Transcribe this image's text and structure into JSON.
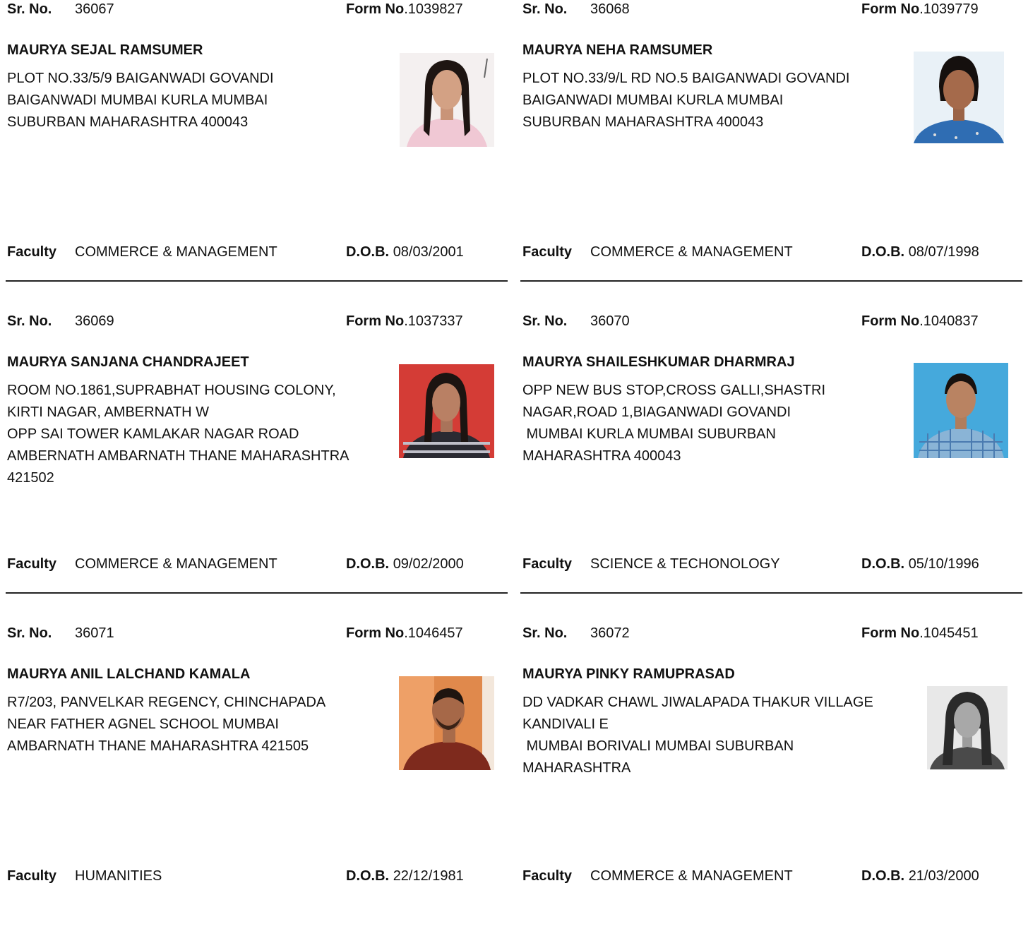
{
  "labels": {
    "sr": "Sr. No.",
    "form": "Form No",
    "faculty": "Faculty",
    "dob": "D.O.B."
  },
  "records": [
    {
      "sr_no": "36067",
      "form_no": ".1039827",
      "name": "MAURYA SEJAL RAMSUMER",
      "address": [
        "PLOT NO.33/5/9 BAIGANWADI GOVANDI",
        "BAIGANWADI MUMBAI KURLA MUMBAI",
        "SUBURBAN MAHARASHTRA 400043"
      ],
      "faculty": "COMMERCE & MANAGEMENT",
      "dob": "08/03/2001"
    },
    {
      "sr_no": "36068",
      "form_no": ".1039779",
      "name": "MAURYA NEHA RAMSUMER",
      "address": [
        "PLOT NO.33/9/L RD NO.5 BAIGANWADI GOVANDI",
        "BAIGANWADI MUMBAI KURLA MUMBAI",
        "SUBURBAN MAHARASHTRA 400043"
      ],
      "faculty": "COMMERCE & MANAGEMENT",
      "dob": "08/07/1998"
    },
    {
      "sr_no": "36069",
      "form_no": ".1037337",
      "name": "MAURYA SANJANA CHANDRAJEET",
      "address": [
        "ROOM NO.1861,SUPRABHAT HOUSING COLONY,",
        "KIRTI NAGAR, AMBERNATH W",
        "OPP SAI TOWER KAMLAKAR NAGAR ROAD",
        "AMBERNATH AMBARNATH THANE MAHARASHTRA",
        "421502"
      ],
      "faculty": "COMMERCE & MANAGEMENT",
      "dob": "09/02/2000"
    },
    {
      "sr_no": "36070",
      "form_no": ".1040837",
      "name": "MAURYA SHAILESHKUMAR DHARMRAJ",
      "address": [
        "OPP NEW BUS STOP,CROSS GALLI,SHASTRI",
        "NAGAR,ROAD 1,BIAGANWADI GOVANDI",
        " MUMBAI KURLA MUMBAI SUBURBAN",
        "MAHARASHTRA 400043"
      ],
      "faculty": "SCIENCE & TECHONOLOGY",
      "dob": "05/10/1996"
    },
    {
      "sr_no": "36071",
      "form_no": ".1046457",
      "name": "MAURYA ANIL LALCHAND KAMALA",
      "address": [
        "R7/203, PANVELKAR REGENCY, CHINCHAPADA",
        "NEAR FATHER AGNEL SCHOOL MUMBAI",
        "AMBARNATH THANE MAHARASHTRA 421505"
      ],
      "faculty": "HUMANITIES",
      "dob": "22/12/1981"
    },
    {
      "sr_no": "36072",
      "form_no": ".1045451",
      "name": "MAURYA PINKY RAMUPRASAD",
      "address": [
        "DD VADKAR CHAWL JIWALAPADA THAKUR VILLAGE",
        "KANDIVALI E",
        " MUMBAI BORIVALI MUMBAI SUBURBAN",
        "MAHARASHTRA"
      ],
      "faculty": "COMMERCE & MANAGEMENT",
      "dob": "21/03/2000"
    }
  ]
}
